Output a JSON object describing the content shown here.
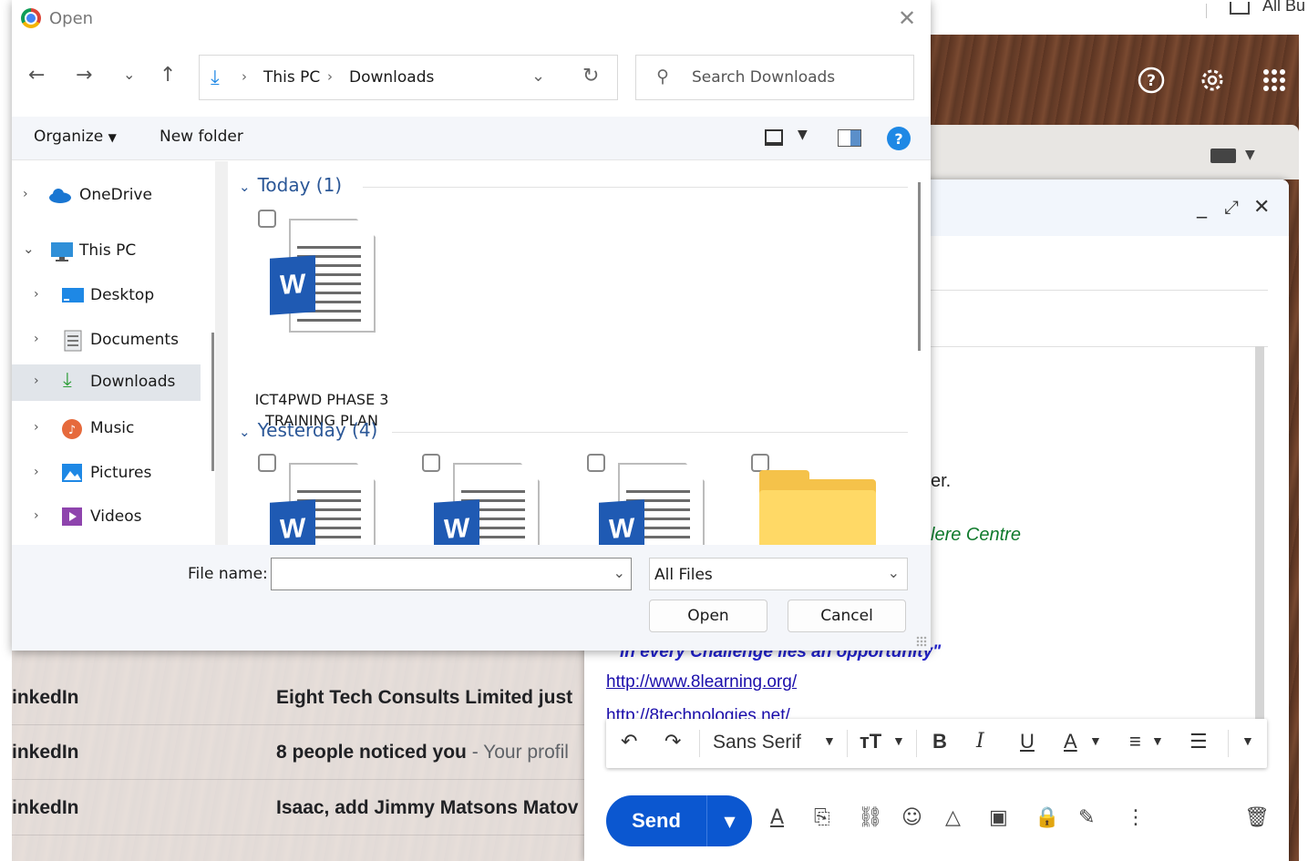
{
  "dialog": {
    "title": "Open",
    "breadcrumb": [
      "This PC",
      "Downloads"
    ],
    "search_placeholder": "Search Downloads",
    "organize_label": "Organize",
    "new_folder_label": "New folder",
    "help_label": "?",
    "nav_tree": [
      {
        "label": "OneDrive",
        "icon": "cloud-icon"
      },
      {
        "label": "This PC",
        "icon": "monitor-icon"
      },
      {
        "label": "Desktop",
        "icon": "desktop-icon"
      },
      {
        "label": "Documents",
        "icon": "document-icon"
      },
      {
        "label": "Downloads",
        "icon": "download-icon",
        "selected": true
      },
      {
        "label": "Music",
        "icon": "music-icon"
      },
      {
        "label": "Pictures",
        "icon": "pictures-icon"
      },
      {
        "label": "Videos",
        "icon": "videos-icon"
      }
    ],
    "groups": [
      {
        "label": "Today (1)"
      },
      {
        "label": "Yesterday (4)"
      }
    ],
    "files_today": [
      {
        "name": "ICT4PWD PHASE 3 TRAINING PLAN",
        "type": "word"
      }
    ],
    "files_yesterday": [
      {
        "type": "word"
      },
      {
        "type": "word"
      },
      {
        "type": "word"
      },
      {
        "type": "folder"
      }
    ],
    "file_name_label": "File name:",
    "file_name_value": "",
    "file_type_value": "All Files",
    "open_label": "Open",
    "cancel_label": "Cancel",
    "word_badge": "W"
  },
  "background": {
    "top_right_text": "All Bu",
    "email_rows": [
      {
        "sender": "inkedIn",
        "subject": "Eight Tech Consults Limited just",
        "snippet": ""
      },
      {
        "sender": "inkedIn",
        "subject": "8 people noticed you",
        "snippet": " - Your profil"
      },
      {
        "sender": "inkedIn",
        "subject": "Isaac, add Jimmy Matsons Matov",
        "snippet": ""
      }
    ],
    "compose": {
      "body_fragment_1": "er.",
      "body_fragment_2": "lere Centre",
      "signature_quote": "\"In every Challenge lies an opportunity\"",
      "link_1": "http://www.8learning.org/",
      "link_2": "http://8technologies.net/",
      "font_name": "Sans Serif",
      "send_label": "Send",
      "accent": "#0b57d0"
    }
  }
}
